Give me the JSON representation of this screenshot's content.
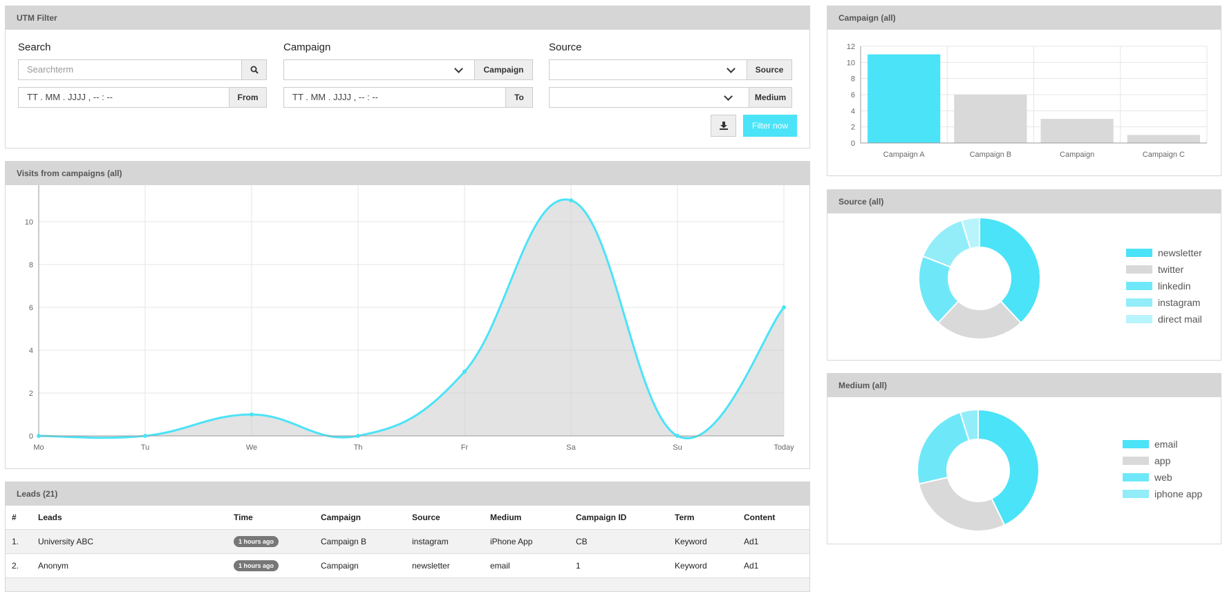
{
  "utm_filter": {
    "title": "UTM Filter",
    "search_label": "Search",
    "search_placeholder": "Searchterm",
    "campaign_label": "Campaign",
    "campaign_button": "Campaign",
    "source_label": "Source",
    "source_button": "Source",
    "from_placeholder": "TT . MM . JJJJ ,  -- : --",
    "from_button": "From",
    "to_placeholder": "TT . MM . JJJJ ,  -- : --",
    "to_button": "To",
    "medium_button": "Medium",
    "filter_button": "Filter now",
    "download_icon": "download-icon",
    "search_icon": "search-icon"
  },
  "visits_panel": {
    "title": "Visits from campaigns (all)"
  },
  "campaign_panel": {
    "title": "Campaign (all)"
  },
  "source_panel": {
    "title": "Source (all)"
  },
  "medium_panel": {
    "title": "Medium (all)"
  },
  "leads": {
    "title": "Leads (21)",
    "columns": [
      "#",
      "Leads",
      "Time",
      "Campaign",
      "Source",
      "Medium",
      "Campaign ID",
      "Term",
      "Content"
    ],
    "rows": [
      [
        "1.",
        "University ABC",
        "1 hours ago",
        "Campaign B",
        "instagram",
        "iPhone App",
        "CB",
        "Keyword",
        "Ad1"
      ],
      [
        "2.",
        "Anonym",
        "1 hours ago",
        "Campaign",
        "newsletter",
        "email",
        "1",
        "Keyword",
        "Ad1"
      ]
    ]
  },
  "colors": {
    "accent": "#4be3f7",
    "gray": "#d9d9d9",
    "header": "#d6d6d6"
  },
  "chart_data": [
    {
      "type": "area",
      "title": "Visits from campaigns (all)",
      "x": [
        "Mo",
        "Tu",
        "We",
        "Th",
        "Fr",
        "Sa",
        "Su",
        "Today"
      ],
      "series": [
        {
          "values": [
            0,
            0,
            1,
            0,
            3,
            11,
            0,
            6
          ]
        }
      ],
      "ylim": [
        0,
        12
      ],
      "yticks": [
        0,
        2,
        4,
        6,
        8,
        10,
        12
      ],
      "grid": true
    },
    {
      "type": "bar",
      "title": "Campaign (all)",
      "categories": [
        "Campaign A",
        "Campaign B",
        "Campaign",
        "Campaign C"
      ],
      "values": [
        11,
        6,
        3,
        1
      ],
      "ylim": [
        0,
        12
      ],
      "yticks": [
        0,
        2,
        4,
        6,
        8,
        10,
        12
      ],
      "grid": true
    },
    {
      "type": "pie",
      "title": "Source (all)",
      "labels": [
        "newsletter",
        "twitter",
        "linkedin",
        "instagram",
        "direct mail"
      ],
      "values": [
        8,
        5,
        4,
        3,
        1
      ],
      "colors": [
        "#4be3f7",
        "#d9d9d9",
        "#6ee8f8",
        "#92edf9",
        "#b8f4fb"
      ],
      "legend": "right"
    },
    {
      "type": "pie",
      "title": "Medium (all)",
      "labels": [
        "email",
        "app",
        "web",
        "iphone app"
      ],
      "values": [
        9,
        6,
        5,
        1
      ],
      "colors": [
        "#4be3f7",
        "#d9d9d9",
        "#6ee8f8",
        "#92edf9"
      ],
      "legend": "right"
    }
  ]
}
